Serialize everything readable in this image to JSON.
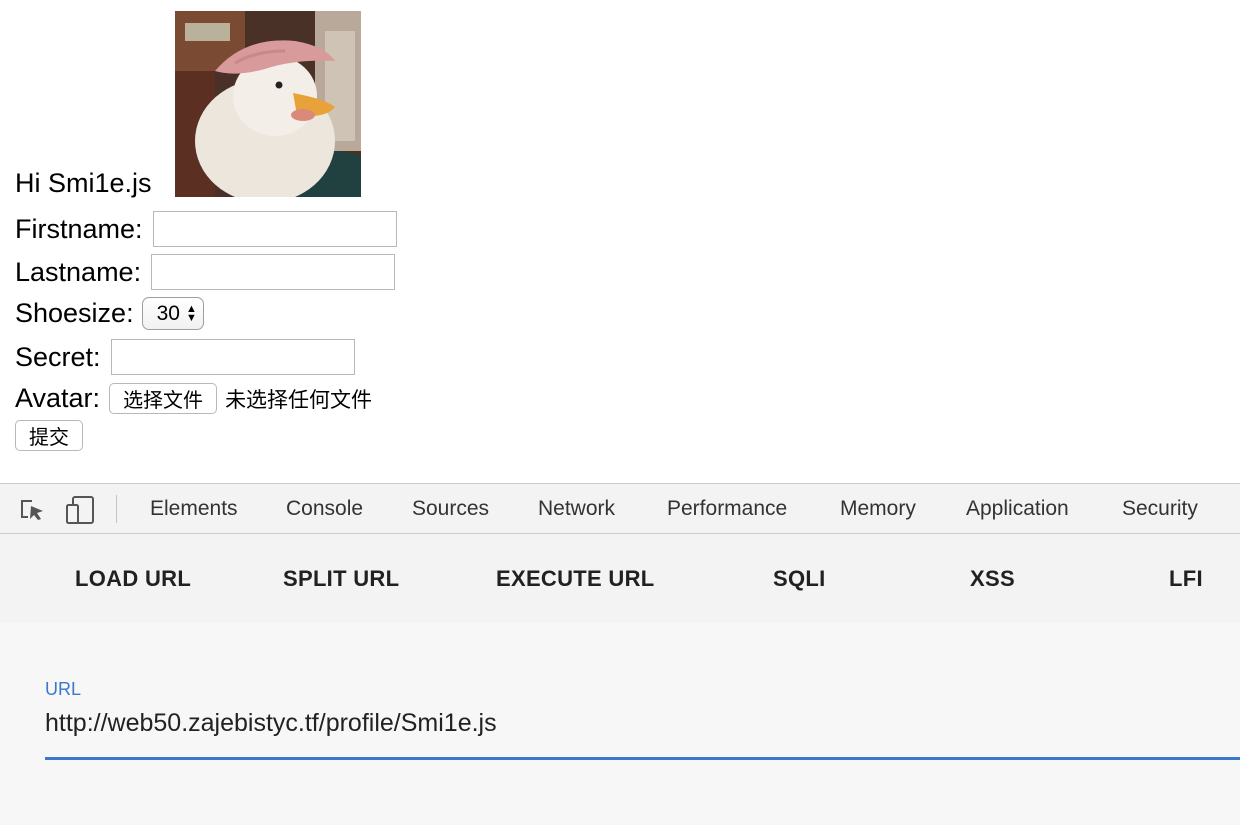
{
  "profile": {
    "greeting": "Hi Smi1e.js",
    "avatar_alt": "duck photo"
  },
  "form": {
    "firstname_label": "Firstname:",
    "firstname_value": "",
    "lastname_label": "Lastname:",
    "lastname_value": "",
    "shoesize_label": "Shoesize:",
    "shoesize_value": "30",
    "secret_label": "Secret:",
    "secret_value": "",
    "avatar_label": "Avatar:",
    "choose_file_button": "选择文件",
    "no_file_text": "未选择任何文件",
    "submit_button": "提交"
  },
  "devtools": {
    "tabs": [
      "Elements",
      "Console",
      "Sources",
      "Network",
      "Performance",
      "Memory",
      "Application",
      "Security"
    ],
    "icons": [
      "inspect-element-icon",
      "device-toolbar-icon"
    ]
  },
  "hackbar": {
    "buttons": [
      "LOAD URL",
      "SPLIT URL",
      "EXECUTE URL",
      "SQLI",
      "XSS",
      "LFI"
    ],
    "url_label": "URL",
    "url_value": "http://web50.zajebistyc.tf/profile/Smi1e.js",
    "accent_color": "#3a78c9"
  }
}
